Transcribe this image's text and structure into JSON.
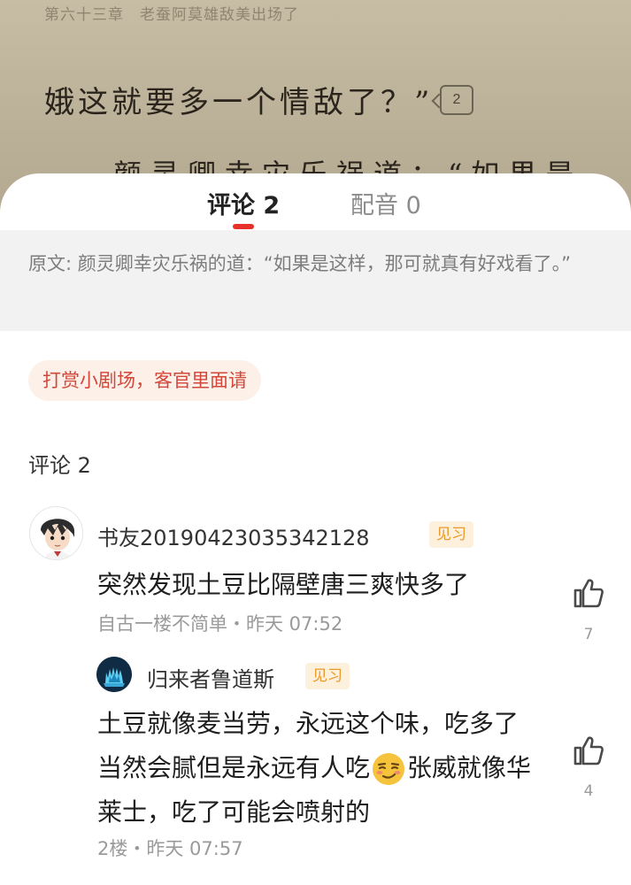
{
  "book": {
    "chapter_header": "第六十三章　老蚕阿莫雄敌美出场了",
    "line1": "娥这就要多一个情敌了？”",
    "comment_bubble_count": "2",
    "line2": "颜灵卿幸灾乐祸道：“如果是"
  },
  "tabs": [
    {
      "label": "评论 2",
      "active": true
    },
    {
      "label": "配音 0",
      "active": false
    }
  ],
  "original": {
    "text": "原文: 颜灵卿幸灾乐祸的道：“如果是这样，那可就真有好戏看了。”"
  },
  "reward_pill": "打赏小剧场，客官里面请",
  "comments_heading": "评论 2",
  "comments": [
    {
      "username": "书友20190423035342128",
      "badge": "见习",
      "text": "突然发现土豆比隔壁唐三爽快多了",
      "meta": "自古一楼不简单・昨天 07:52",
      "likes": "7",
      "avatar": "anime-boy-avatar"
    },
    {
      "username": "归来者鲁道斯",
      "badge": "见习",
      "text_before": "土豆就像麦当劳，永远这个味，吃多了当然会腻但是永远有人吃",
      "emoji": "smirk-emoji",
      "text_after": "张威就像华莱士，吃了可能会喷射的",
      "meta": "2楼・昨天 07:57",
      "likes": "4",
      "avatar": "blue-coral-avatar"
    }
  ],
  "colors": {
    "accent_red": "#e8302a",
    "badge_text": "#e89a2c",
    "badge_bg": "#fdf1dd",
    "reward_text": "#d2473a"
  }
}
